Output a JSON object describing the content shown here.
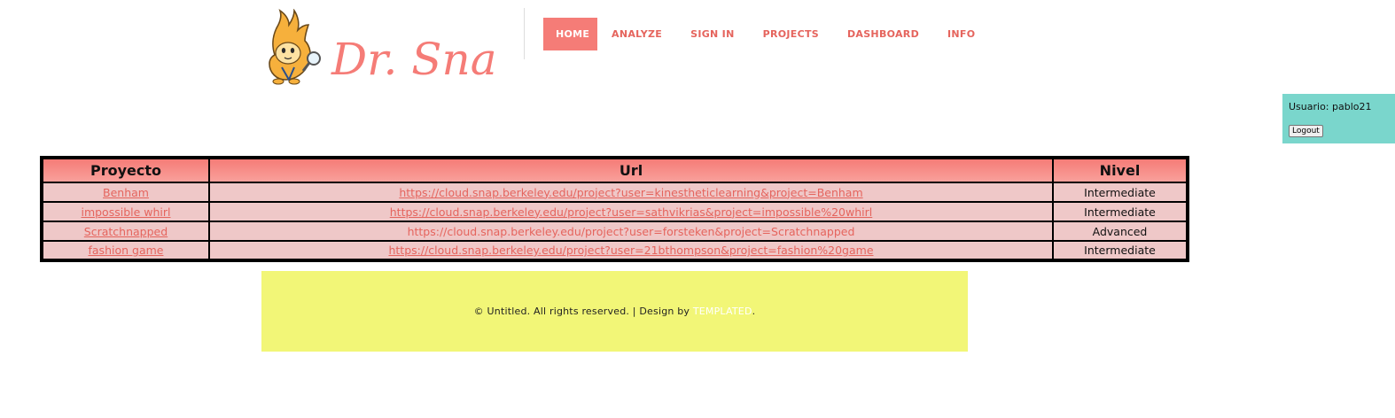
{
  "brand": {
    "logo_text": "Dr. Snap!"
  },
  "nav": {
    "items": [
      {
        "label": "HOME",
        "active": true
      },
      {
        "label": "ANALYZE",
        "active": false
      },
      {
        "label": "SIGN IN",
        "active": false
      },
      {
        "label": "PROJECTS",
        "active": false
      },
      {
        "label": "DASHBOARD",
        "active": false
      },
      {
        "label": "INFO",
        "active": false
      }
    ]
  },
  "user_panel": {
    "user_text": "Usuario: pablo21",
    "logout_label": "Logout",
    "color": "#7ad6cc"
  },
  "table": {
    "headers": [
      "Proyecto",
      "Url",
      "Nivel"
    ],
    "rows": [
      {
        "name": "Benham",
        "url": "https://cloud.snap.berkeley.edu/project?user=kinestheticlearning&project=Benham",
        "url_underlined": true,
        "level": "Intermediate"
      },
      {
        "name": "impossible whirl",
        "url": "https://cloud.snap.berkeley.edu/project?user=sathvikrias&project=impossible%20whirl",
        "url_underlined": true,
        "level": "Intermediate"
      },
      {
        "name": "Scratchnapped",
        "url": "https://cloud.snap.berkeley.edu/project?user=forsteken&project=Scratchnapped",
        "url_underlined": false,
        "level": "Advanced"
      },
      {
        "name": "fashion game",
        "url": "https://cloud.snap.berkeley.edu/project?user=21bthompson&project=fashion%20game",
        "url_underlined": true,
        "level": "Intermediate"
      }
    ]
  },
  "footer": {
    "text_before": "© Untitled. All rights reserved. | Design by ",
    "link_label": "TEMPLATED",
    "text_after": "."
  },
  "colors": {
    "accent": "#f57c77",
    "link": "#e5645d",
    "row_bg": "#efc8c8",
    "footer_bg": "#f2f677"
  }
}
